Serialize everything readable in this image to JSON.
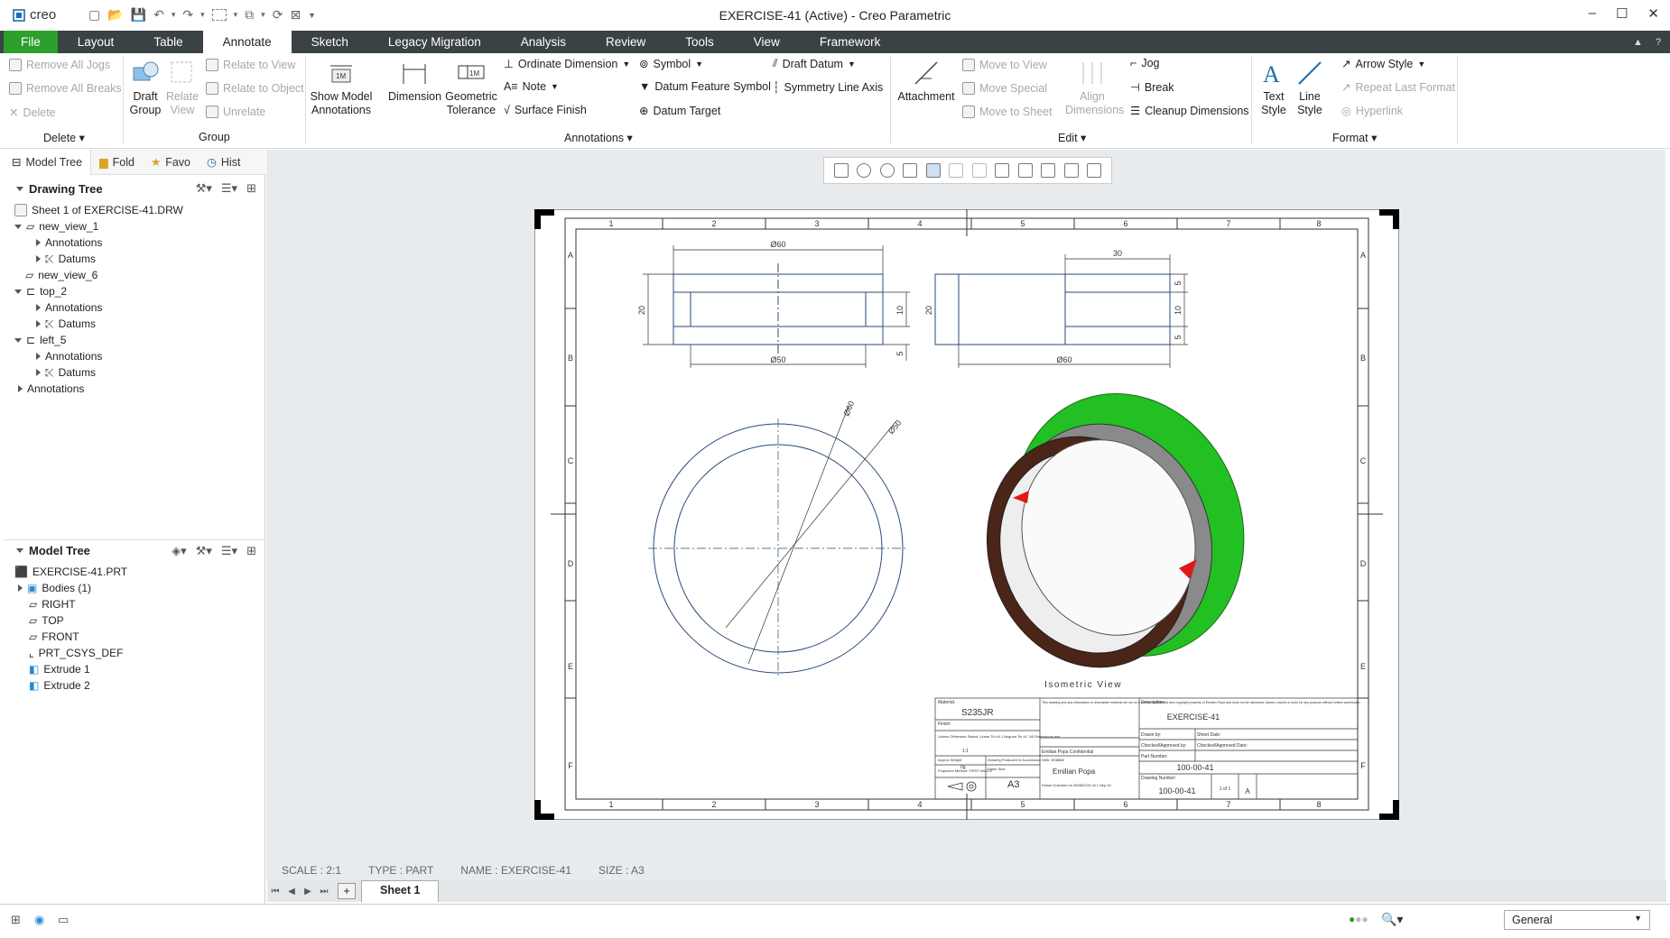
{
  "window": {
    "title": "EXERCISE-41 (Active) - Creo Parametric",
    "app_name": "creo"
  },
  "menu_tabs": [
    "File",
    "Layout",
    "Table",
    "Annotate",
    "Sketch",
    "Legacy Migration",
    "Analysis",
    "Review",
    "Tools",
    "View",
    "Framework"
  ],
  "active_tab": "Annotate",
  "ribbon": {
    "delete_group": {
      "items": [
        "Remove All Jogs",
        "Remove All Breaks",
        "Delete"
      ],
      "label": "Delete"
    },
    "group_group": {
      "draft_group": "Draft Group",
      "relate_view": "Relate View",
      "relate_to_view": "Relate to View",
      "relate_to_object": "Relate to Object",
      "unrelate": "Unrelate",
      "label": "Group"
    },
    "annotations_group": {
      "show_model_annotations": "Show Model Annotations",
      "dimension": "Dimension",
      "geometric_tolerance": "Geometric Tolerance",
      "ordinate_dimension": "Ordinate Dimension",
      "note": "Note",
      "surface_finish": "Surface Finish",
      "symbol": "Symbol",
      "datum_feature_symbol": "Datum Feature Symbol",
      "datum_target": "Datum Target",
      "draft_datum": "Draft Datum",
      "symmetry_line_axis": "Symmetry Line Axis",
      "label": "Annotations"
    },
    "edit_group": {
      "attachment": "Attachment",
      "move_to_view": "Move to View",
      "move_special": "Move Special",
      "move_to_sheet": "Move to Sheet",
      "align_dimensions": "Align Dimensions",
      "jog": "Jog",
      "break": "Break",
      "cleanup_dimensions": "Cleanup Dimensions",
      "label": "Edit"
    },
    "format_group": {
      "text_style": "Text Style",
      "line_style": "Line Style",
      "arrow_style": "Arrow Style",
      "repeat_last_format": "Repeat Last Format",
      "hyperlink": "Hyperlink",
      "label": "Format"
    }
  },
  "panel_tabs": [
    "Model Tree",
    "Fold",
    "Favo",
    "Hist"
  ],
  "drawing_tree": {
    "title": "Drawing Tree",
    "rows": [
      "Sheet 1 of EXERCISE-41.DRW",
      "new_view_1",
      "Annotations",
      "Datums",
      "new_view_6",
      "top_2",
      "Annotations",
      "Datums",
      "left_5",
      "Annotations",
      "Datums",
      "Annotations"
    ]
  },
  "model_tree": {
    "title": "Model Tree",
    "rows": [
      "EXERCISE-41.PRT",
      "Bodies (1)",
      "RIGHT",
      "TOP",
      "FRONT",
      "PRT_CSYS_DEF",
      "Extrude 1",
      "Extrude 2"
    ]
  },
  "drawing": {
    "column_labels": [
      "1",
      "2",
      "3",
      "4",
      "5",
      "6",
      "7",
      "8"
    ],
    "row_labels": [
      "A",
      "B",
      "C",
      "D",
      "E",
      "F"
    ],
    "dims": {
      "front_top": "Ø60",
      "front_bottom": "Ø50",
      "front_left": "20",
      "front_right": "10",
      "front_right_small": "5",
      "side_top": "30",
      "side_left": "20",
      "side_right_top": "5",
      "side_right_mid": "10",
      "side_right_bottom": "5",
      "side_bottom": "Ø60",
      "circle_60": "Ø60",
      "circle_50": "Ø50"
    },
    "iso_label": "Isometric View",
    "title_block": {
      "material_label": "Material:",
      "material": "S235JR",
      "finish_label": "Finish:",
      "notes": "Unless Otherwise Stated: Linear Tol ±0.1 Angular Tol ±1° All Dimensions mm",
      "weight_label": "Approx Weight:",
      "weight": "0g",
      "drawing_note": "Drawing Produced in Accordance With: BS8888",
      "projection": "Projection Method: FIRST ANGLE",
      "sheet_size_label": "Sheet Size:",
      "sheet_size": "A3",
      "scale": "1:1",
      "confidential": "This drawing and any information or descriptive material set out on it are the confidential and copyright property of Emilian Popa and must not be disclosed, loaned, copied or used for any purpose without written permission.",
      "company_confidential": "Emilian Popa Confidential",
      "company": "Emilian Popa",
      "description_label": "Description:",
      "description": "EXERCISE-41",
      "drawn_by": "Drawn by:",
      "sheet_date": "Sheet Date:",
      "checked": "Checked/Approved by:",
      "checked_date": "Checked/Approved Date:",
      "part_number_label": "Part Number:",
      "part_number": "100-00-41",
      "drawing_number_label": "Drawing Number:",
      "drawing_number": "100-00-41",
      "sheet": "1 of 1",
      "revision": "A",
      "printed": "Drawn Checked on 05/08/2022 at 1 Sep 00"
    }
  },
  "status": {
    "scale": "SCALE : 2:1",
    "type": "TYPE : PART",
    "name": "NAME : EXERCISE-41",
    "size": "SIZE : A3"
  },
  "sheet_tab": "Sheet 1",
  "filter_select": "General",
  "colors": {
    "menubar": "#3a4246",
    "file_tab": "#2c9f2c",
    "canvas_bg": "#e7ebee",
    "drawing_line": "#2a4a7a",
    "iso_green": "#22c022",
    "iso_brown": "#4a2518",
    "iso_red": "#e01818"
  }
}
